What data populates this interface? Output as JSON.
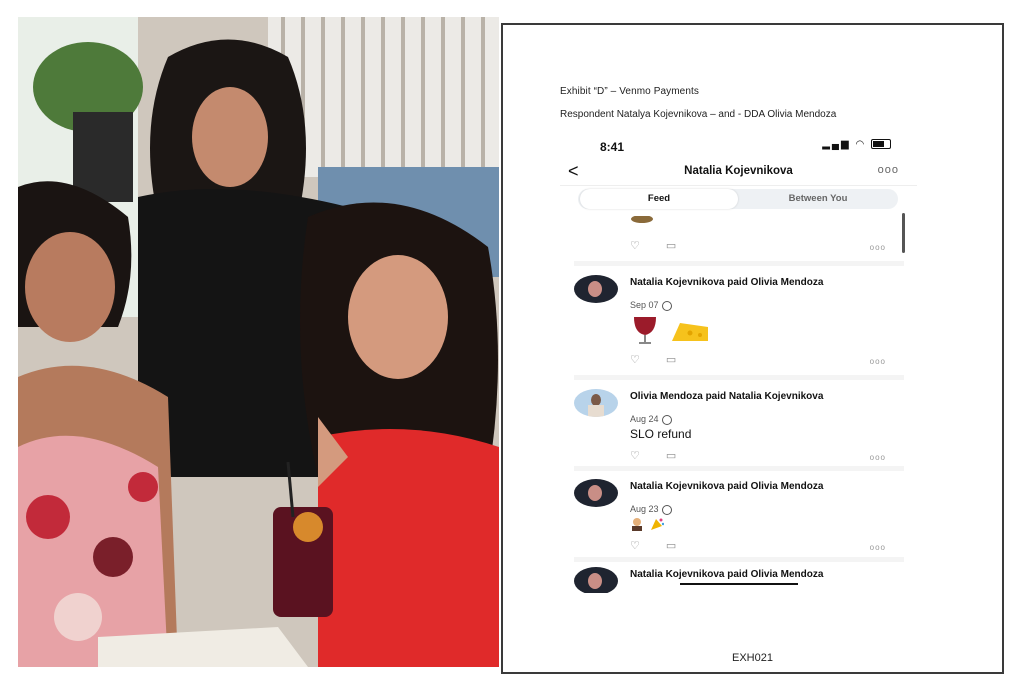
{
  "exhibit": {
    "title": "Exhibit “D” – Venmo Payments",
    "parties": "Respondent Natalya Kojevnikova – and -  DDA Olivia Mendoza",
    "footer": "EXH021"
  },
  "phone": {
    "time": "8:41",
    "header_title": "Natalia Kojevnikova",
    "back_label": "<",
    "more_label": "ooo",
    "tabs": [
      "Feed",
      "Between You"
    ],
    "active_tab": "Feed",
    "action_more": "ooo",
    "feed": [
      {
        "headline": "Natalia Kojevnikova paid Olivia Mendoza",
        "date": "Sep 07",
        "note": "",
        "emoji": [
          "wine-glass",
          "cheese-wedge"
        ]
      },
      {
        "headline": "Olivia Mendoza paid Natalia Kojevnikova",
        "date": "Aug 24",
        "note": "SLO refund",
        "emoji": []
      },
      {
        "headline": "Natalia Kojevnikova paid Olivia Mendoza",
        "date": "Aug 23",
        "note": "",
        "emoji": [
          "person-emoji",
          "party-popper"
        ]
      },
      {
        "headline": "Natalia Kojevnikova paid Olivia Mendoza",
        "date": "",
        "note": "",
        "emoji": []
      }
    ]
  },
  "colors": {
    "accent_tab": "#eef1f4",
    "text": "#111111",
    "red_dress": "#e02a2a"
  }
}
